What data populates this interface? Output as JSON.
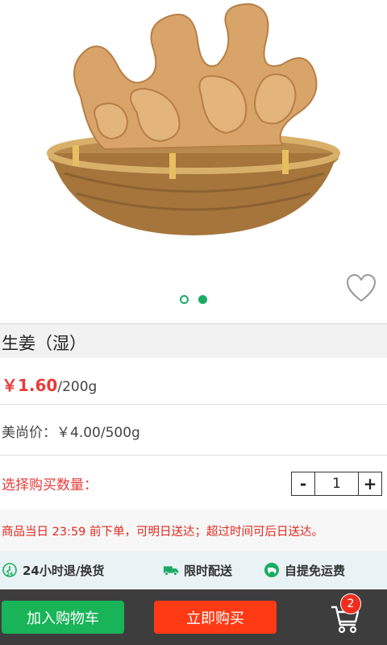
{
  "product": {
    "name": "生姜（湿）",
    "price": "￥1.60",
    "price_unit": "/200g",
    "market_price": "美尚价：￥4.00/500g"
  },
  "carousel": {
    "total": 2,
    "active": 2
  },
  "quantity": {
    "label": "选择购买数量：",
    "minus": "-",
    "value": "1",
    "plus": "+"
  },
  "notice": "商品当日 23:59 前下单，可明日送达；超过时间可后日送达。",
  "services": [
    {
      "label": "24小时退/换货",
      "icon": "clock-24-icon"
    },
    {
      "label": "限时配送",
      "icon": "truck-icon"
    },
    {
      "label": "自提免运费",
      "icon": "pickup-icon"
    }
  ],
  "actions": {
    "add_to_cart": "加入购物车",
    "buy_now": "立即购买"
  },
  "cart": {
    "count": "2"
  },
  "colors": {
    "green": "#1aab64",
    "red": "#e83a3a",
    "orange": "#ff3a14"
  }
}
